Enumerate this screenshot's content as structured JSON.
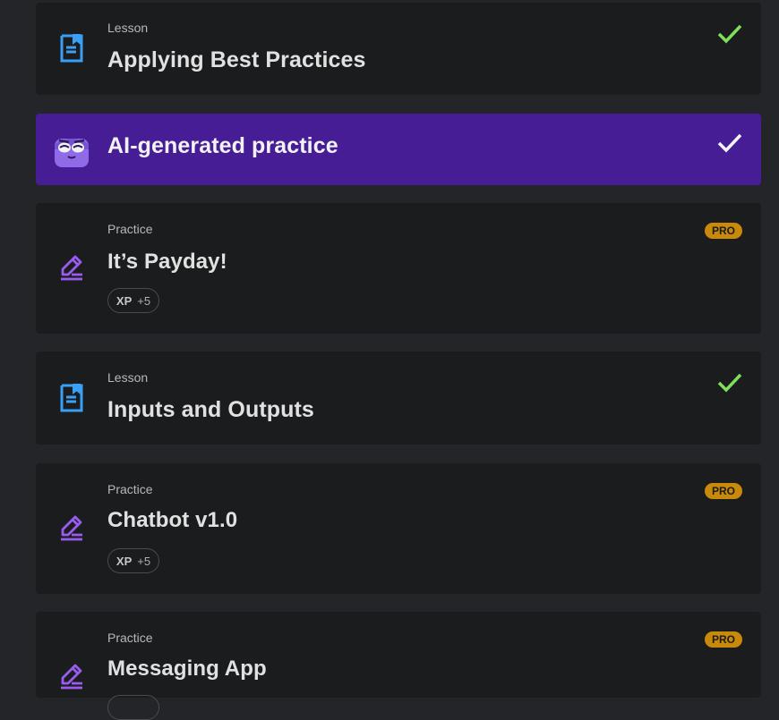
{
  "items": [
    {
      "kind": "Lesson",
      "title": "Applying Best Practices",
      "icon": "lesson-icon",
      "completed": true
    },
    {
      "title": "AI-generated practice",
      "icon": "ai-mascot-icon",
      "completed": true
    },
    {
      "kind": "Practice",
      "title": "It’s Payday!",
      "icon": "practice-pencil-icon",
      "badge": "PRO",
      "xp_label": "XP",
      "xp_value": "+5"
    },
    {
      "kind": "Lesson",
      "title": "Inputs and Outputs",
      "icon": "lesson-icon",
      "completed": true
    },
    {
      "kind": "Practice",
      "title": "Chatbot v1.0",
      "icon": "practice-pencil-icon",
      "badge": "PRO",
      "xp_label": "XP",
      "xp_value": "+5"
    },
    {
      "kind": "Practice",
      "title": "Messaging App",
      "icon": "practice-pencil-icon",
      "badge": "PRO"
    }
  ],
  "colors": {
    "background": "#242528",
    "card": "#1b1c1e",
    "ai_card": "#461d94",
    "check_green": "#7ee05a",
    "pro_badge": "#c9890a",
    "lesson_icon": "#3aa0f5",
    "practice_icon": "#9a5cf0"
  }
}
